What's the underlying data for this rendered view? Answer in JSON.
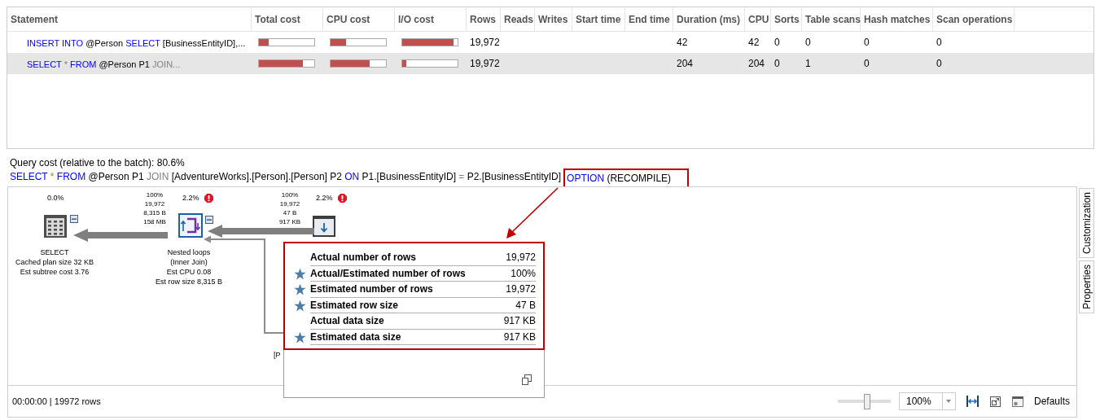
{
  "statements_grid": {
    "columns": [
      "Statement",
      "Total cost",
      "CPU cost",
      "I/O cost",
      "Rows",
      "Reads",
      "Writes",
      "Start time",
      "End time",
      "Duration (ms)",
      "CPU",
      "Sorts",
      "Table scans",
      "Hash matches",
      "Scan operations"
    ],
    "rows": [
      {
        "selected": false,
        "statement": [
          {
            "text": "INSERT INTO",
            "kind": "keyword"
          },
          {
            "text": " @Person ",
            "kind": "plain"
          },
          {
            "text": "SELECT",
            "kind": "keyword"
          },
          {
            "text": " [BusinessEntityID],...",
            "kind": "plain"
          }
        ],
        "total_cost": {
          "level": 0.18
        },
        "cpu_cost": {
          "level": 0.28
        },
        "io_cost": {
          "level": 0.92
        },
        "rows": "19,972",
        "duration_ms": "42",
        "cpu": "42",
        "sorts": "0",
        "table_scans": "0",
        "hash_matches": "0",
        "scan_operations": "0"
      },
      {
        "selected": true,
        "statement": [
          {
            "text": "SELECT",
            "kind": "keyword"
          },
          {
            "text": " * ",
            "kind": "operator"
          },
          {
            "text": "FROM",
            "kind": "keyword"
          },
          {
            "text": " @Person P1 ",
            "kind": "plain"
          },
          {
            "text": "JOIN...",
            "kind": "operator"
          }
        ],
        "total_cost": {
          "level": 0.8
        },
        "cpu_cost": {
          "level": 0.7
        },
        "io_cost": {
          "level": 0.08
        },
        "rows": "19,972",
        "duration_ms": "204",
        "cpu": "204",
        "sorts": "0",
        "table_scans": "1",
        "hash_matches": "0",
        "scan_operations": "0"
      }
    ]
  },
  "query": {
    "cost_line": "Query cost (relative to the batch):  80.6%",
    "sql": [
      {
        "text": "SELECT",
        "kind": "keyword"
      },
      {
        "text": " * ",
        "kind": "operator"
      },
      {
        "text": "FROM",
        "kind": "keyword"
      },
      {
        "text": " @Person P1 ",
        "kind": "plain"
      },
      {
        "text": "JOIN",
        "kind": "operator"
      },
      {
        "text": " [AdventureWorks].[Person].[Person] P2 ",
        "kind": "plain"
      },
      {
        "text": "ON",
        "kind": "keyword"
      },
      {
        "text": " P1.[BusinessEntityID] ",
        "kind": "plain"
      },
      {
        "text": "=",
        "kind": "operator"
      },
      {
        "text": " P2.[BusinessEntityID] ",
        "kind": "plain"
      }
    ],
    "hint": {
      "highlighted": true,
      "segments": [
        {
          "text": "OPTION",
          "kind": "keyword"
        },
        {
          "text": " (RECOMPILE)",
          "kind": "plain"
        }
      ]
    }
  },
  "plan": {
    "nodes": [
      {
        "kind": "select",
        "cost": "0.0%",
        "warning": false,
        "labels": [
          "SELECT",
          "Cached plan size  32 KB",
          "Est subtree cost  3.76"
        ]
      },
      {
        "kind": "nested_loops",
        "cost": "2.2%",
        "warning": true,
        "labels": [
          "Nested loops",
          "(Inner Join)",
          "Est CPU  0.08",
          "Est row size  8,315 B"
        ]
      },
      {
        "kind": "scan",
        "cost": "2.2%",
        "warning": true,
        "labels": [
          "[P"
        ]
      }
    ],
    "edges": [
      {
        "labels": [
          "100%",
          "19,972",
          "8,315 B",
          "158 MB"
        ]
      },
      {
        "labels": [
          "100%",
          "19,972",
          "47 B",
          "917 KB"
        ]
      }
    ],
    "tooltip": {
      "highlighted": true,
      "rows": [
        {
          "label": "Actual number of rows",
          "value": "19,972",
          "starred": false
        },
        {
          "label": "Actual/Estimated number of rows",
          "value": "100%",
          "starred": true
        },
        {
          "label": "Estimated number of rows",
          "value": "19,972",
          "starred": true
        },
        {
          "label": "Estimated row size",
          "value": "47 B",
          "starred": true
        },
        {
          "label": "Actual data size",
          "value": "917 KB",
          "starred": false
        },
        {
          "label": "Estimated data size",
          "value": "917 KB",
          "starred": true
        }
      ]
    },
    "status": "00:00:00 | 19972 rows",
    "zoom_slider": {
      "level": 0.55
    },
    "zoom_value": "100%",
    "defaults_button": "Defaults"
  },
  "side_tabs": [
    "Customization",
    "Properties"
  ]
}
